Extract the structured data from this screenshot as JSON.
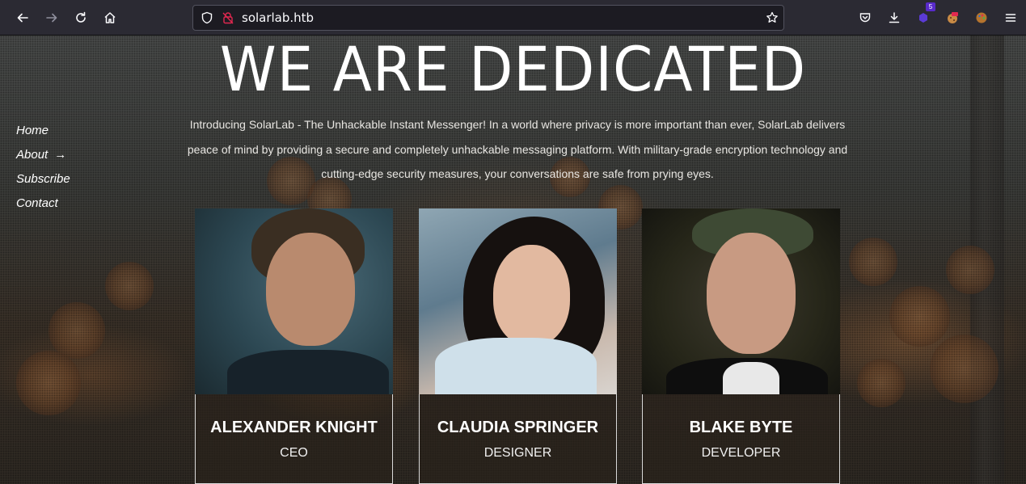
{
  "browser": {
    "url": "solarlab.htb",
    "extension_badge": "5"
  },
  "page": {
    "hero_title": "WE ARE DEDICATED",
    "intro_text": "Introducing SolarLab - The Unhackable Instant Messenger! In a world where privacy is more important than ever, SolarLab delivers peace of mind by providing a secure and completely unhackable messaging platform. With military-grade encryption technology and cutting-edge security measures, your conversations are safe from prying eyes.",
    "nav": [
      {
        "label": "Home"
      },
      {
        "label": "About",
        "arrow": "→"
      },
      {
        "label": "Subscribe"
      },
      {
        "label": "Contact"
      }
    ],
    "team": [
      {
        "name": "ALEXANDER KNIGHT",
        "role": "CEO"
      },
      {
        "name": "CLAUDIA SPRINGER",
        "role": "DESIGNER"
      },
      {
        "name": "BLAKE BYTE",
        "role": "DEVELOPER"
      }
    ]
  }
}
